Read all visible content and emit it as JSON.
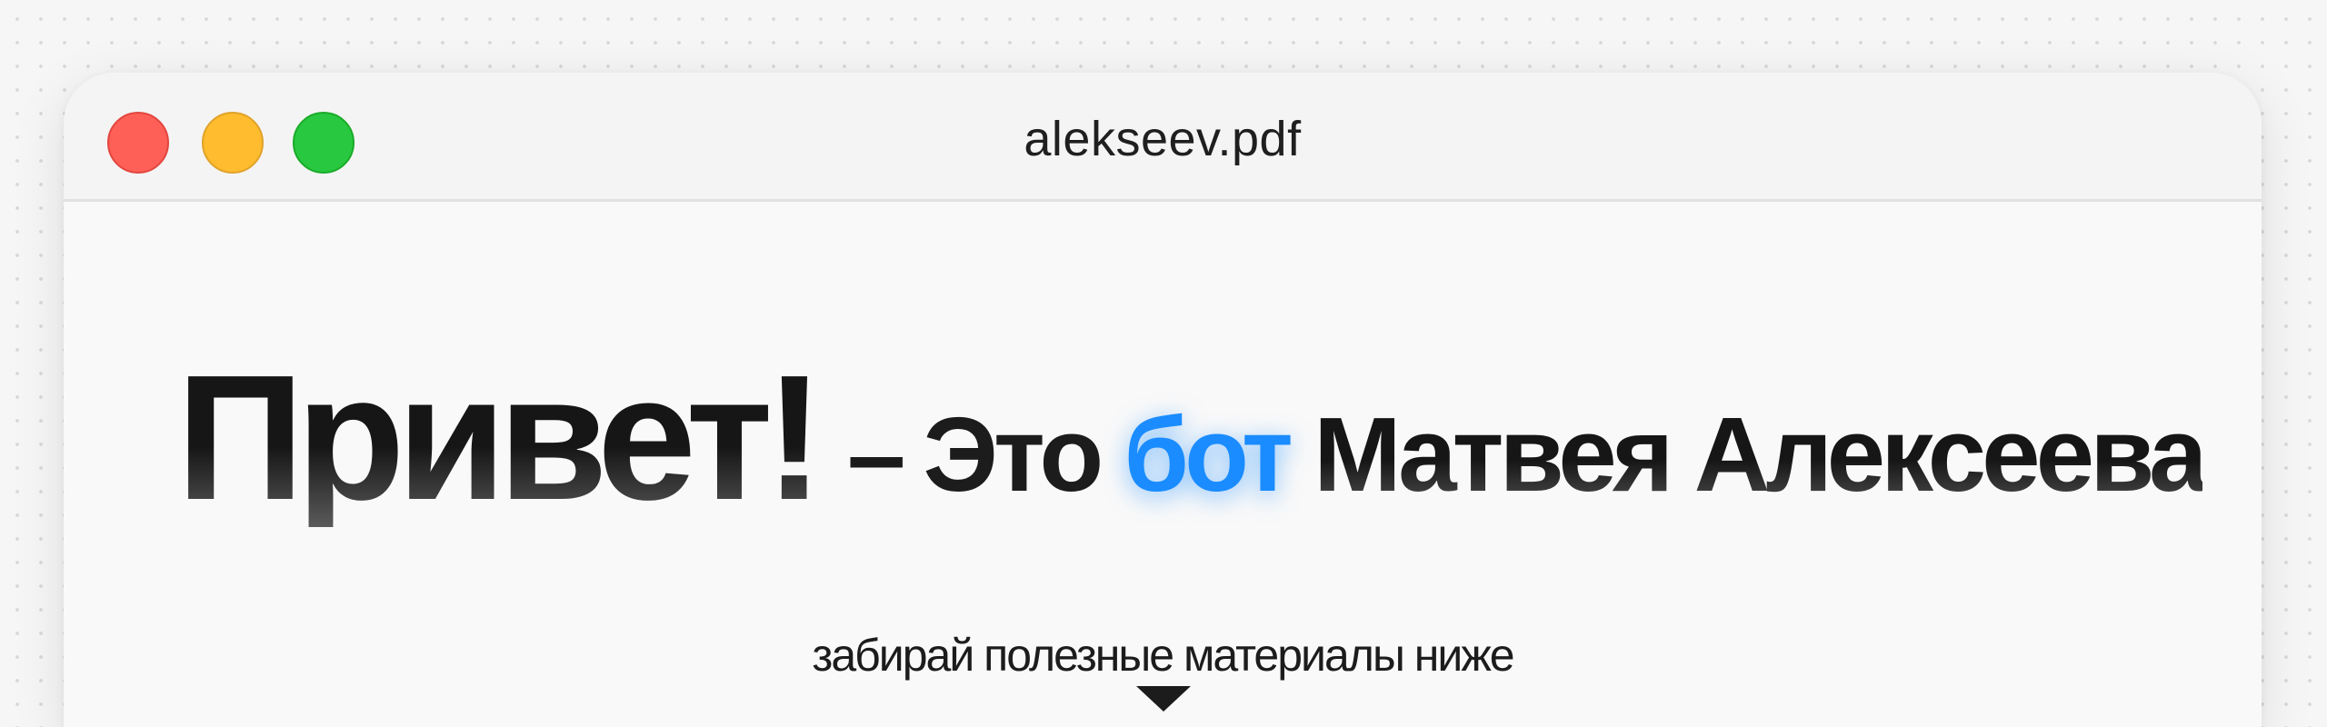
{
  "window": {
    "title": "alekseev.pdf",
    "controls": [
      "close",
      "minimize",
      "maximize"
    ]
  },
  "hero": {
    "greeting": "Привет!",
    "dash": "–",
    "tagline_before": "Это",
    "tagline_accent": "бот",
    "tagline_after": "Матвея Алексеева"
  },
  "cta": {
    "text": "забирай полезные материалы ниже",
    "arrow_icon": "triangle-down-icon"
  },
  "colors": {
    "accent": "#1a8cff",
    "close": "#fe5f57",
    "minimize": "#febc2e",
    "maximize": "#28c840"
  }
}
